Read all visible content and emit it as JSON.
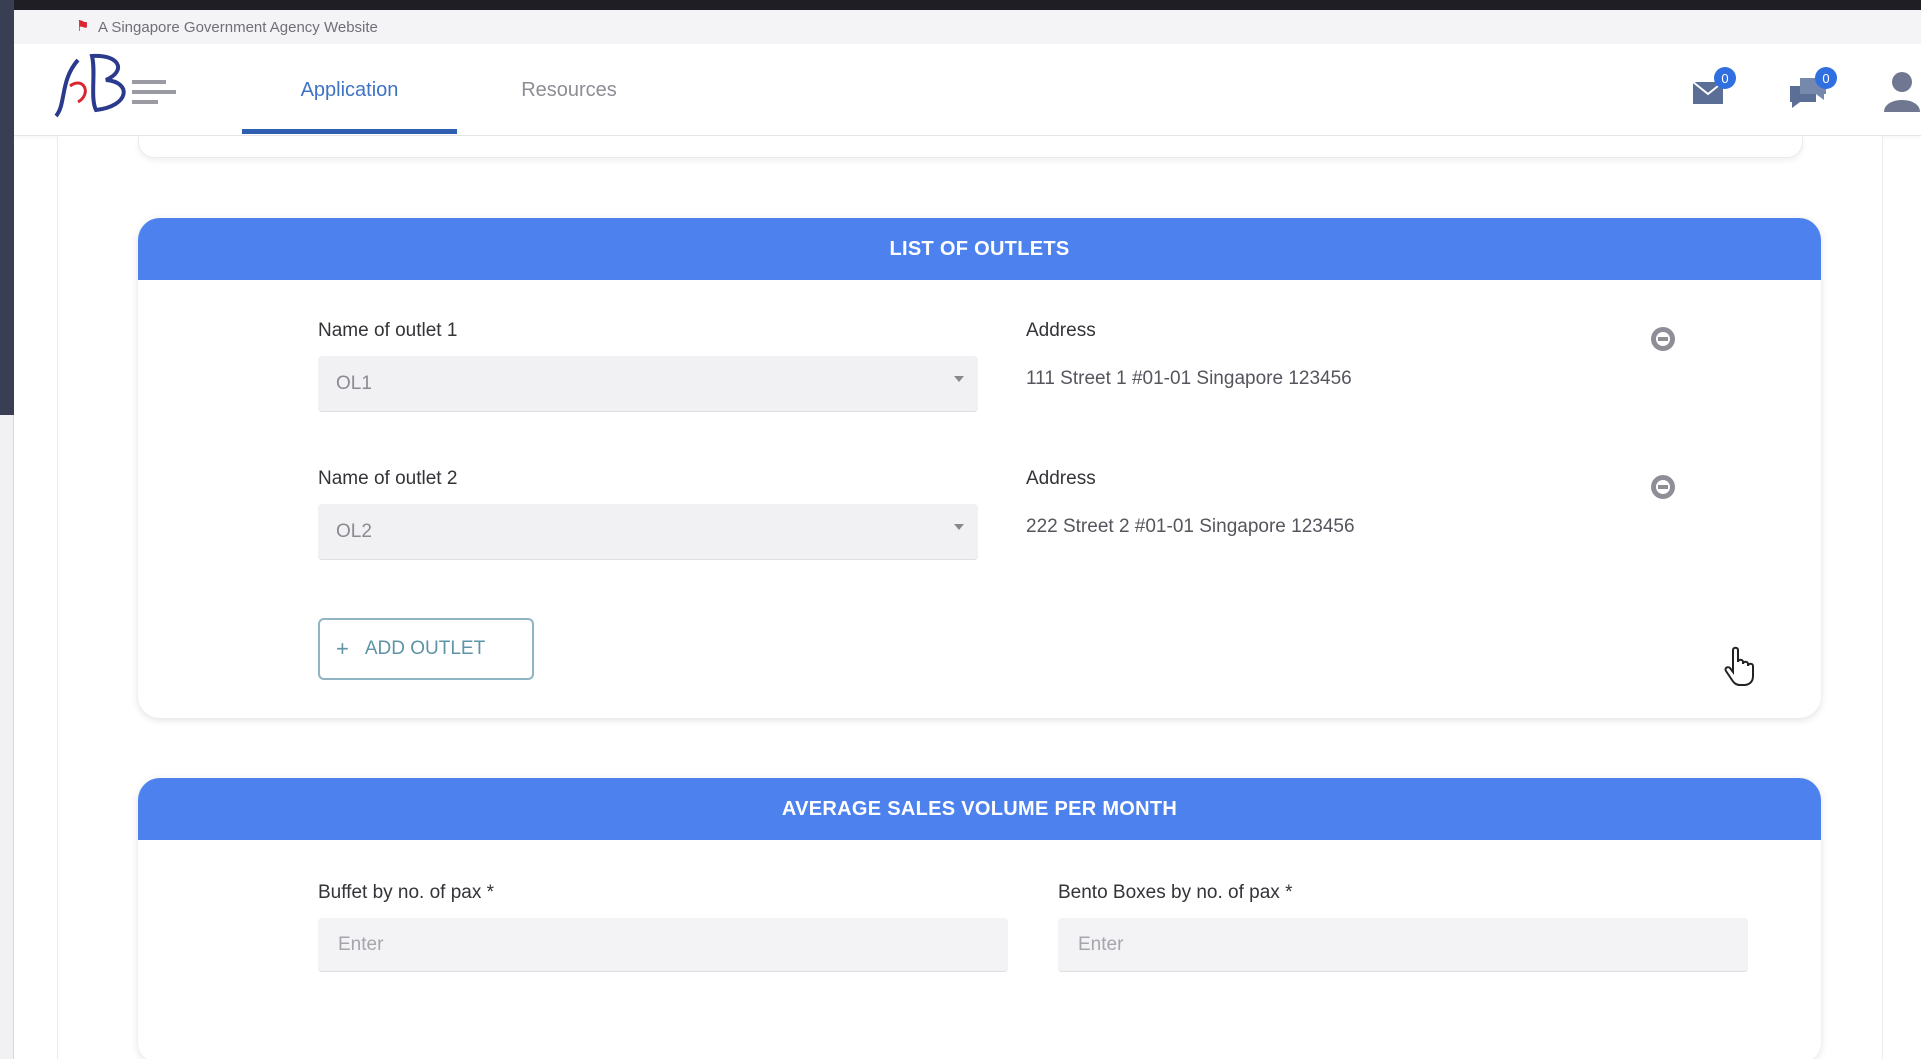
{
  "masthead": {
    "text": "A Singapore Government Agency Website"
  },
  "nav": {
    "tabs": [
      {
        "label": "Application",
        "active": true
      },
      {
        "label": "Resources",
        "active": false
      }
    ],
    "icons": [
      "mail-icon",
      "chat-icon",
      "user-icon"
    ],
    "badges": {
      "mail": "0",
      "chat": "0"
    }
  },
  "outlets_section": {
    "title": "LIST OF OUTLETS",
    "outlets": [
      {
        "name_label": "Name of outlet 1",
        "selected": "OL1",
        "address_label": "Address",
        "address": "111 Street 1 #01-01 Singapore 123456"
      },
      {
        "name_label": "Name of outlet 2",
        "selected": "OL2",
        "address_label": "Address",
        "address": "222 Street 2 #01-01 Singapore 123456"
      }
    ],
    "add_button": "ADD OUTLET"
  },
  "sales_section": {
    "title": "AVERAGE SALES VOLUME PER MONTH",
    "fields": [
      {
        "label": "Buffet by no. of pax *",
        "placeholder": "Enter"
      },
      {
        "label": "Bento Boxes by no. of pax *",
        "placeholder": "Enter"
      }
    ]
  },
  "colors": {
    "header_blue": "#4d82ee",
    "tab_active": "#3e73c4",
    "add_button_border": "#8fb4c2"
  }
}
